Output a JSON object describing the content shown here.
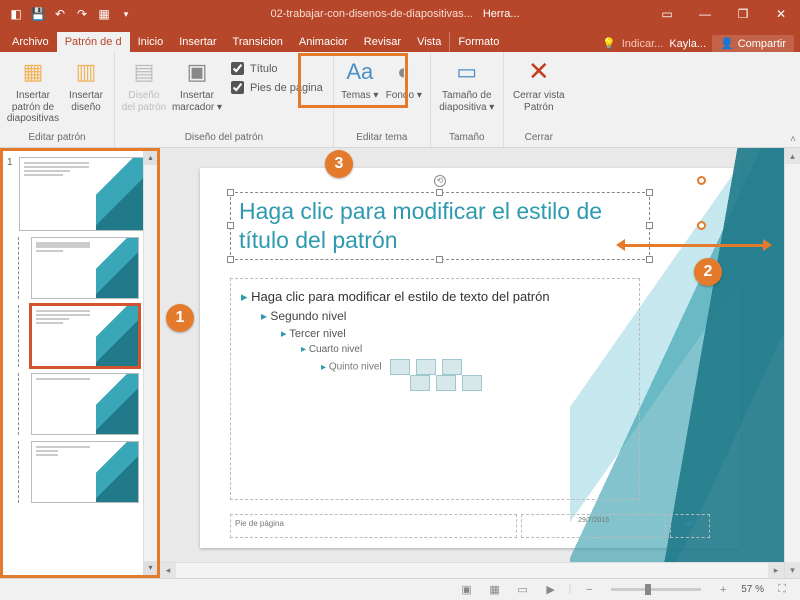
{
  "titlebar": {
    "doc_name": "02-trabajar-con-disenos-de-diapositivas...",
    "context_tool": "Herra..."
  },
  "tabs": {
    "archivo": "Archivo",
    "patron": "Patrón de d",
    "inicio": "Inicio",
    "insertar": "Insertar",
    "transiciones": "Transicion",
    "animaciones": "Animacior",
    "revisar": "Revisar",
    "vista": "Vista",
    "formato": "Formato"
  },
  "tellme": {
    "hint": "Indicar...",
    "user": "Kayla...",
    "share": "Compartir"
  },
  "ribbon": {
    "group_editar": {
      "label": "Editar patrón",
      "btn_insertar_patron": "Insertar patrón de diapositivas",
      "btn_insertar_diseno": "Insertar diseño"
    },
    "group_disenopatron": {
      "label": "Diseño del patrón",
      "btn_diseno": "Diseño del patrón",
      "btn_marcador": "Insertar marcador ▾",
      "chk_titulo": "Título",
      "chk_pies": "Pies de página"
    },
    "group_editartema": {
      "label": "Editar tema",
      "btn_temas": "Temas ▾",
      "btn_fondo": "Fondo ▾"
    },
    "group_tamano": {
      "label": "Tamaño",
      "btn_tamano": "Tamaño de diapositiva ▾"
    },
    "group_cerrar": {
      "label": "Cerrar",
      "btn_cerrar": "Cerrar vista Patrón"
    }
  },
  "thumbnails": {
    "master_num": "1"
  },
  "slide": {
    "title": "Haga clic para modificar el estilo de título del patrón",
    "l1": "Haga clic para modificar el estilo de texto del patrón",
    "l2": "Segundo nivel",
    "l3": "Tercer nivel",
    "l4": "Cuarto nivel",
    "l5": "Quinto nivel",
    "footer": "Pie de página",
    "date": "29/7/2015",
    "slidenum": "‹#›"
  },
  "status": {
    "zoom": "57 %"
  },
  "callouts": {
    "c1": "1",
    "c2": "2",
    "c3": "3"
  }
}
